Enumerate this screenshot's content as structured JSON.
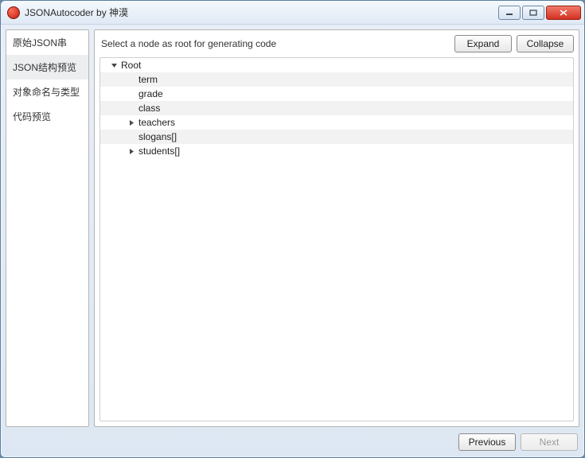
{
  "window": {
    "title": "JSONAutocoder by 神漠"
  },
  "sidebar": {
    "items": [
      {
        "label": "原始JSON串",
        "selected": false
      },
      {
        "label": "JSON结构预览",
        "selected": true
      },
      {
        "label": "对象命名与类型",
        "selected": false
      },
      {
        "label": "代码预览",
        "selected": false
      }
    ]
  },
  "main": {
    "hint": "Select a node as root for generating code",
    "expand_label": "Expand",
    "collapse_label": "Collapse"
  },
  "tree": {
    "rows": [
      {
        "label": "Root",
        "depth": 0,
        "arrow": "down",
        "alt": false
      },
      {
        "label": "term",
        "depth": 1,
        "arrow": "none",
        "alt": true
      },
      {
        "label": "grade",
        "depth": 1,
        "arrow": "none",
        "alt": false
      },
      {
        "label": "class",
        "depth": 1,
        "arrow": "none",
        "alt": true
      },
      {
        "label": "teachers",
        "depth": 1,
        "arrow": "right",
        "alt": false
      },
      {
        "label": "slogans[]",
        "depth": 1,
        "arrow": "none",
        "alt": true
      },
      {
        "label": "students[]",
        "depth": 1,
        "arrow": "right",
        "alt": false
      }
    ]
  },
  "footer": {
    "previous_label": "Previous",
    "next_label": "Next",
    "next_enabled": false
  }
}
